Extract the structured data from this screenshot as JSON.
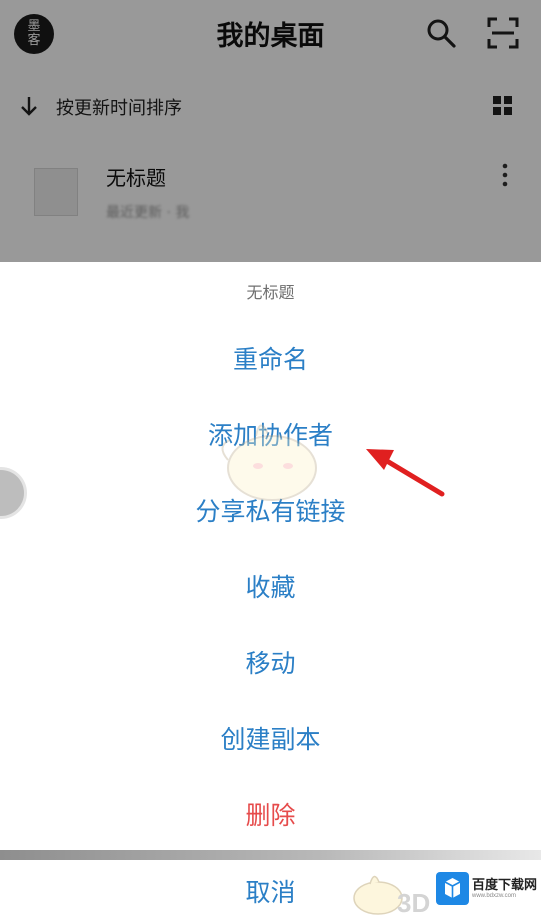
{
  "header": {
    "avatar_line1": "墨",
    "avatar_line2": "客",
    "title": "我的桌面",
    "search_icon": "search-icon",
    "scan_icon": "scan-icon"
  },
  "sortbar": {
    "label": "按更新时间排序",
    "arrow_icon": "arrow-down-icon",
    "view_icon": "grid-view-icon"
  },
  "file": {
    "name": "无标题",
    "meta": "最近更新 · 我",
    "more_icon": "more-vertical-icon"
  },
  "sheet": {
    "title": "无标题",
    "actions": [
      {
        "label": "重命名"
      },
      {
        "label": "添加协作者"
      },
      {
        "label": "分享私有链接"
      },
      {
        "label": "收藏"
      },
      {
        "label": "移动"
      },
      {
        "label": "创建副本"
      },
      {
        "label": "删除"
      }
    ],
    "cancel": "取消"
  },
  "watermark": {
    "brand_3d": "3D",
    "site": "百度下载网",
    "site_sub": "www.bdxzw.com"
  },
  "colors": {
    "action": "#2b7fc6",
    "danger": "#e64b4b",
    "annotation_arrow": "#e02020"
  }
}
